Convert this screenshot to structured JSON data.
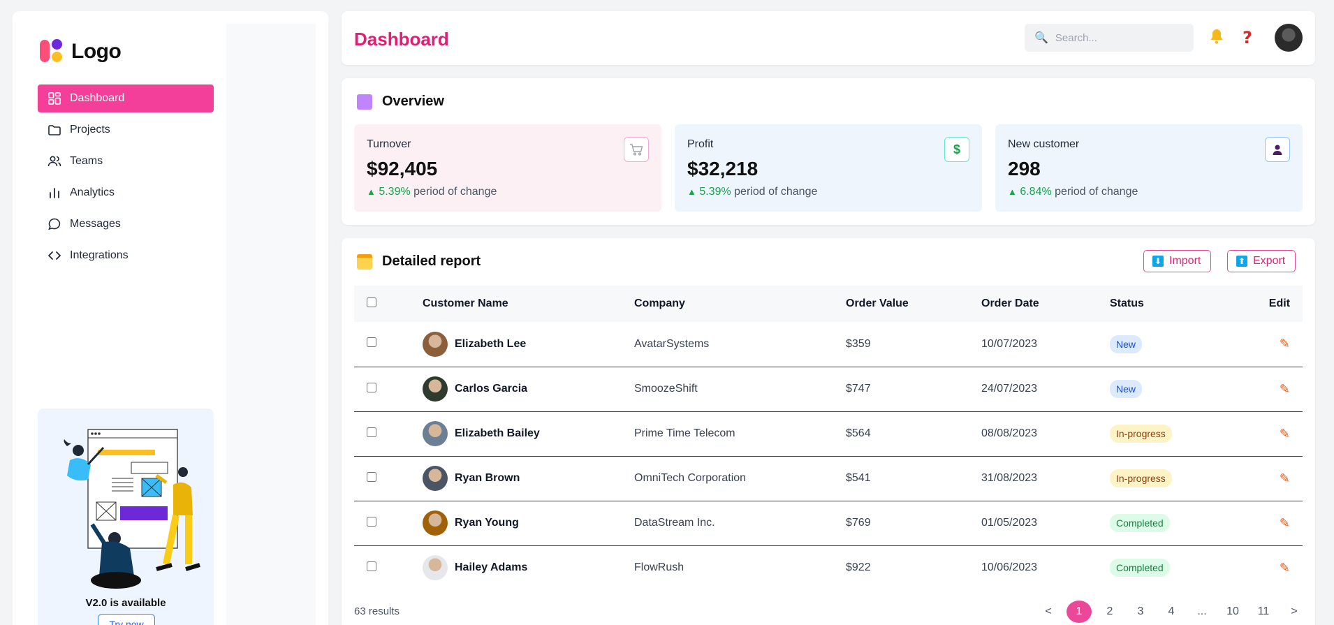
{
  "sidebar": {
    "logo_text": "Logo",
    "items": [
      {
        "label": "Dashboard",
        "icon": "grid-icon"
      },
      {
        "label": "Projects",
        "icon": "folder-icon"
      },
      {
        "label": "Teams",
        "icon": "users-icon"
      },
      {
        "label": "Analytics",
        "icon": "bar-chart-icon"
      },
      {
        "label": "Messages",
        "icon": "message-icon"
      },
      {
        "label": "Integrations",
        "icon": "code-icon"
      }
    ],
    "promo": {
      "title": "V2.0 is available",
      "button": "Try now"
    }
  },
  "header": {
    "title": "Dashboard",
    "search_placeholder": "Search..."
  },
  "overview": {
    "title": "Overview",
    "cards": [
      {
        "label": "Turnover",
        "value": "$92,405",
        "pct": "5.39%",
        "suffix": "period of change",
        "icon": "cart-icon",
        "bg": "#fdf0f5",
        "border": "#f9a8d4"
      },
      {
        "label": "Profit",
        "value": "$32,218",
        "pct": "5.39%",
        "suffix": "period of change",
        "icon": "dollar-icon",
        "bg": "#eef5fd",
        "border": "#7dd3fc"
      },
      {
        "label": "New customer",
        "value": "298",
        "pct": "6.84%",
        "suffix": "period of change",
        "icon": "user-icon",
        "bg": "#eef5fd",
        "border": "#93c5fd"
      }
    ]
  },
  "report": {
    "title": "Detailed report",
    "import": "Import",
    "export": "Export",
    "columns": [
      "Customer Name",
      "Company",
      "Order Value",
      "Order Date",
      "Status",
      "Edit"
    ],
    "rows": [
      {
        "name": "Elizabeth Lee",
        "company": "AvatarSystems",
        "value": "$359",
        "date": "10/07/2023",
        "status": "New",
        "status_type": "new"
      },
      {
        "name": "Carlos Garcia",
        "company": "SmoozeShift",
        "value": "$747",
        "date": "24/07/2023",
        "status": "New",
        "status_type": "new"
      },
      {
        "name": "Elizabeth Bailey",
        "company": "Prime Time Telecom",
        "value": "$564",
        "date": "08/08/2023",
        "status": "In-progress",
        "status_type": "prog"
      },
      {
        "name": "Ryan Brown",
        "company": "OmniTech Corporation",
        "value": "$541",
        "date": "31/08/2023",
        "status": "In-progress",
        "status_type": "prog"
      },
      {
        "name": "Ryan Young",
        "company": "DataStream Inc.",
        "value": "$769",
        "date": "01/05/2023",
        "status": "Completed",
        "status_type": "done"
      },
      {
        "name": "Hailey Adams",
        "company": "FlowRush",
        "value": "$922",
        "date": "10/06/2023",
        "status": "Completed",
        "status_type": "done"
      }
    ],
    "results": "63 results",
    "pages": [
      "<",
      "1",
      "2",
      "3",
      "4",
      "...",
      "10",
      "11",
      ">"
    ],
    "current_page": "1"
  },
  "colors": {
    "accent": "#ec4899",
    "title": "#e11d74"
  }
}
